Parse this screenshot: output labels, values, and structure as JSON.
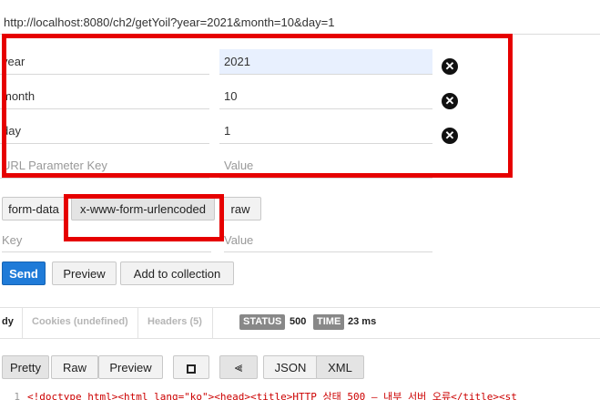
{
  "url": "http://localhost:8080/ch2/getYoil?year=2021&month=10&day=1",
  "params": [
    {
      "key": "year",
      "value": "2021"
    },
    {
      "key": "month",
      "value": "10"
    },
    {
      "key": "day",
      "value": "1"
    }
  ],
  "param_placeholders": {
    "key": "URL Parameter Key",
    "value": "Value"
  },
  "body_tabs": {
    "form_data": "form-data",
    "urlencoded": "x-www-form-urlencoded",
    "raw": "raw"
  },
  "body_placeholders": {
    "key": "Key",
    "value": "Value"
  },
  "actions": {
    "send": "Send",
    "preview": "Preview",
    "add_collection": "Add to collection"
  },
  "response_tabs": {
    "body": "dy",
    "cookies": "Cookies (undefined)",
    "headers": "Headers (5)"
  },
  "status": {
    "label": "STATUS",
    "value": "500",
    "time_label": "TIME",
    "time_value": "23 ms"
  },
  "view_buttons": {
    "pretty": "Pretty",
    "raw": "Raw",
    "preview": "Preview",
    "json": "JSON",
    "xml": "XML"
  },
  "code": {
    "line_number": "1",
    "text": "<!doctype html><html lang=\"ko\"><head><title>HTTP 상태 500 – 내부 서버 오류</title><st"
  },
  "colors": {
    "highlight_box": "#e60000",
    "send_button": "#1f7bd8"
  }
}
